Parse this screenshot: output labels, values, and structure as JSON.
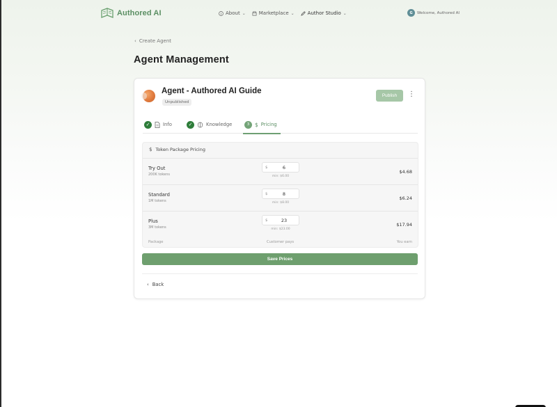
{
  "nav": {
    "brand": "Authored AI",
    "items": [
      {
        "label": "About"
      },
      {
        "label": "Marketplace"
      },
      {
        "label": "Author Studio"
      }
    ],
    "welcome": "Welcome, Authored AI",
    "avatar_initials": "G"
  },
  "breadcrumb": {
    "label": "Create Agent"
  },
  "page_title": "Agent Management",
  "agent": {
    "name": "Agent - Authored AI Guide",
    "status": "Unpublished",
    "publish_label": "Publish"
  },
  "tabs": [
    {
      "label": "Info",
      "state": "complete"
    },
    {
      "label": "Knowledge",
      "state": "complete"
    },
    {
      "label": "Pricing",
      "number": "3",
      "state": "active"
    }
  ],
  "pricing": {
    "heading": "Token Package Pricing",
    "currency_symbol": "$",
    "rows": [
      {
        "name": "Try Out",
        "tokens": "200K tokens",
        "price": "6",
        "min": "min: $6.00",
        "earn": "$4.68"
      },
      {
        "name": "Standard",
        "tokens": "1M tokens",
        "price": "8",
        "min": "min: $8.00",
        "earn": "$6.24"
      },
      {
        "name": "Plus",
        "tokens": "3M tokens",
        "price": "23",
        "min": "min: $23.00",
        "earn": "$17.94"
      }
    ],
    "footer": {
      "package": "Package",
      "customer": "Customer pays",
      "earn": "You earn"
    }
  },
  "actions": {
    "save_label": "Save Prices",
    "back_label": "Back"
  },
  "colors": {
    "brand": "#5b8f63",
    "accent": "#6e9f6e",
    "check": "#2e7d3a",
    "publish_disabled": "#a6c7a7"
  }
}
